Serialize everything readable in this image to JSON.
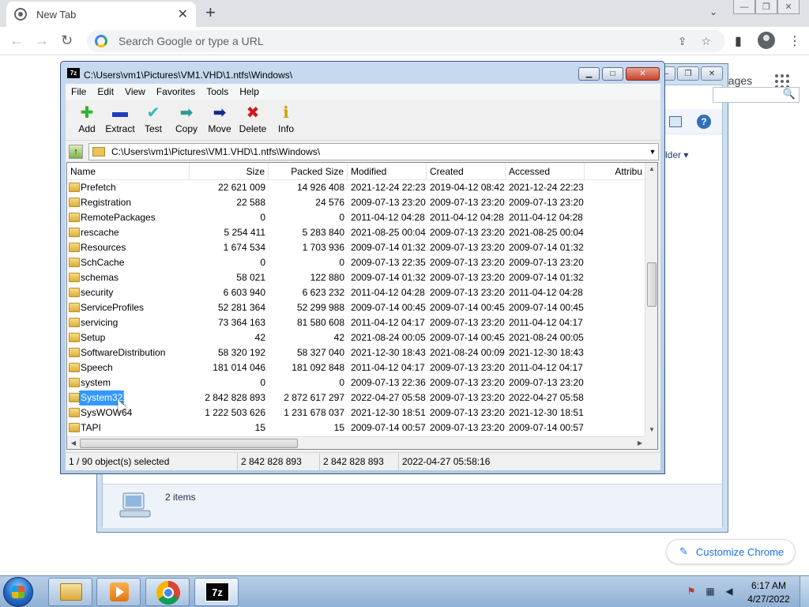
{
  "chrome": {
    "tab_title": "New Tab",
    "tab_close_glyph": "✕",
    "new_tab_glyph": "+",
    "tab_search_glyph": "⌄",
    "window_min": "—",
    "window_max": "❐",
    "window_close": "✕",
    "back_glyph": "←",
    "forward_glyph": "→",
    "reload_glyph": "↻",
    "omnibox_placeholder": "Search Google or type a URL",
    "share_glyph": "⇪",
    "bookmark_glyph": "☆",
    "sidepanel_glyph": "▮",
    "menu_glyph": "⋮",
    "images_link": "nages",
    "customize_label": "Customize Chrome",
    "customize_glyph": "✎"
  },
  "bg_explorer": {
    "search_glyph": "🔍",
    "help_glyph": "?",
    "new_folder_label": "lder ▾",
    "items_label": "2 items",
    "btn_min": "—",
    "btn_max": "❐",
    "btn_close": "✕"
  },
  "sevenzip": {
    "app_icon_text": "7z",
    "title": "C:\\Users\\vm1\\Pictures\\VM1.VHD\\1.ntfs\\Windows\\",
    "btn_min": "▁",
    "btn_max": "□",
    "btn_close": "✕",
    "menu": [
      "File",
      "Edit",
      "View",
      "Favorites",
      "Tools",
      "Help"
    ],
    "toolbar": [
      {
        "label": "Add",
        "glyph": "✚",
        "color": "#2db22d"
      },
      {
        "label": "Extract",
        "glyph": "▬",
        "color": "#1f3fbf"
      },
      {
        "label": "Test",
        "glyph": "✔",
        "color": "#2fb9b9"
      },
      {
        "label": "Copy",
        "glyph": "➡",
        "color": "#2f9a9a"
      },
      {
        "label": "Move",
        "glyph": "➡",
        "color": "#1a2a8a"
      },
      {
        "label": "Delete",
        "glyph": "✖",
        "color": "#d11a1a"
      },
      {
        "label": "Info",
        "glyph": "ℹ",
        "color": "#c9a400"
      }
    ],
    "up_glyph": "↑",
    "address": "C:\\Users\\vm1\\Pictures\\VM1.VHD\\1.ntfs\\Windows\\",
    "address_drop_glyph": "▼",
    "columns": [
      "Name",
      "Size",
      "Packed Size",
      "Modified",
      "Created",
      "Accessed",
      "Attribu"
    ],
    "rows": [
      {
        "name": "Prefetch",
        "size": "22 621 009",
        "packed": "14 926 408",
        "modified": "2021-12-24 22:23",
        "created": "2019-04-12 08:42",
        "accessed": "2021-12-24 22:23"
      },
      {
        "name": "Registration",
        "size": "22 588",
        "packed": "24 576",
        "modified": "2009-07-13 23:20",
        "created": "2009-07-13 23:20",
        "accessed": "2009-07-13 23:20"
      },
      {
        "name": "RemotePackages",
        "size": "0",
        "packed": "0",
        "modified": "2011-04-12 04:28",
        "created": "2011-04-12 04:28",
        "accessed": "2011-04-12 04:28"
      },
      {
        "name": "rescache",
        "size": "5 254 411",
        "packed": "5 283 840",
        "modified": "2021-08-25 00:04",
        "created": "2009-07-13 23:20",
        "accessed": "2021-08-25 00:04"
      },
      {
        "name": "Resources",
        "size": "1 674 534",
        "packed": "1 703 936",
        "modified": "2009-07-14 01:32",
        "created": "2009-07-13 23:20",
        "accessed": "2009-07-14 01:32"
      },
      {
        "name": "SchCache",
        "size": "0",
        "packed": "0",
        "modified": "2009-07-13 22:35",
        "created": "2009-07-13 23:20",
        "accessed": "2009-07-13 23:20"
      },
      {
        "name": "schemas",
        "size": "58 021",
        "packed": "122 880",
        "modified": "2009-07-14 01:32",
        "created": "2009-07-13 23:20",
        "accessed": "2009-07-14 01:32"
      },
      {
        "name": "security",
        "size": "6 603 940",
        "packed": "6 623 232",
        "modified": "2011-04-12 04:28",
        "created": "2009-07-13 23:20",
        "accessed": "2011-04-12 04:28"
      },
      {
        "name": "ServiceProfiles",
        "size": "52 281 364",
        "packed": "52 299 988",
        "modified": "2009-07-14 00:45",
        "created": "2009-07-14 00:45",
        "accessed": "2009-07-14 00:45"
      },
      {
        "name": "servicing",
        "size": "73 364 163",
        "packed": "81 580 608",
        "modified": "2011-04-12 04:17",
        "created": "2009-07-13 23:20",
        "accessed": "2011-04-12 04:17"
      },
      {
        "name": "Setup",
        "size": "42",
        "packed": "42",
        "modified": "2021-08-24 00:05",
        "created": "2009-07-14 00:45",
        "accessed": "2021-08-24 00:05"
      },
      {
        "name": "SoftwareDistribution",
        "size": "58 320 192",
        "packed": "58 327 040",
        "modified": "2021-12-30 18:43",
        "created": "2021-08-24 00:09",
        "accessed": "2021-12-30 18:43"
      },
      {
        "name": "Speech",
        "size": "181 014 046",
        "packed": "181 092 848",
        "modified": "2011-04-12 04:17",
        "created": "2009-07-13 23:20",
        "accessed": "2011-04-12 04:17"
      },
      {
        "name": "system",
        "size": "0",
        "packed": "0",
        "modified": "2009-07-13 22:36",
        "created": "2009-07-13 23:20",
        "accessed": "2009-07-13 23:20"
      },
      {
        "name": "System32",
        "size": "2 842 828 893",
        "packed": "2 872 617 297",
        "modified": "2022-04-27 05:58",
        "created": "2009-07-13 23:20",
        "accessed": "2022-04-27 05:58",
        "selected": true
      },
      {
        "name": "SysWOW64",
        "size": "1 222 503 626",
        "packed": "1 231 678 037",
        "modified": "2021-12-30 18:51",
        "created": "2009-07-13 23:20",
        "accessed": "2021-12-30 18:51"
      },
      {
        "name": "TAPI",
        "size": "15",
        "packed": "15",
        "modified": "2009-07-14 00:57",
        "created": "2009-07-13 23:20",
        "accessed": "2009-07-14 00:57"
      }
    ],
    "status": {
      "selection": "1 / 90 object(s) selected",
      "size": "2 842 828 893",
      "packed": "2 842 828 893",
      "modified": "2022-04-27 05:58:16"
    }
  },
  "taskbar": {
    "seven_zip_label": "7z",
    "time": "6:17 AM",
    "date": "4/27/2022",
    "tray_flag": "⚑",
    "tray_network": "▦",
    "tray_volume": "◀"
  }
}
